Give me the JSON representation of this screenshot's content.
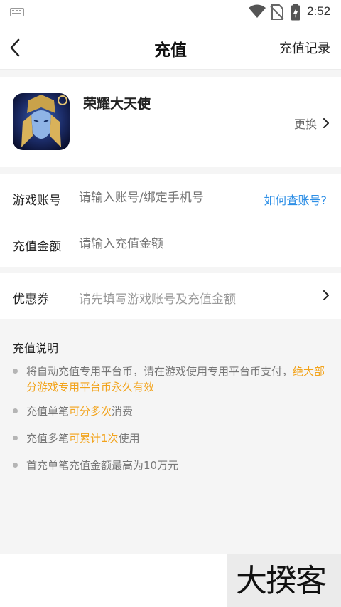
{
  "status_bar": {
    "time": "2:52",
    "icons": [
      "keyboard-icon",
      "wifi-icon",
      "no-sim-icon",
      "battery-charging-icon"
    ]
  },
  "header": {
    "title": "充值",
    "record_label": "充值记录",
    "back_icon": "chevron-left-icon"
  },
  "game": {
    "name": "荣耀大天使",
    "change_label": "更换"
  },
  "form": {
    "account_label": "游戏账号",
    "account_placeholder": "请输入账号/绑定手机号",
    "help_link": "如何查账号?",
    "amount_label": "充值金额",
    "amount_placeholder": "请输入充值金额"
  },
  "coupon": {
    "label": "优惠券",
    "hint": "请先填写游戏账号及充值金额"
  },
  "notes": {
    "title": "充值说明",
    "item1": {
      "a": "将自动充值专用平台币，请在游戏使用专用平台币支付，",
      "b": "绝大部分游戏专用平台币永久有效"
    },
    "item2": {
      "a": "充值单笔",
      "b": "可分多次",
      "c": "消费"
    },
    "item3": {
      "a": "充值多笔",
      "b": "可累计1次",
      "c": "使用"
    },
    "item4": {
      "a": "首充单笔充值金额最高为10万元"
    }
  },
  "watermark": {
    "text": "大揆客"
  },
  "colors": {
    "highlight": "#f2a31b",
    "link": "#2e8fe6",
    "background": "#f5f5f5"
  }
}
